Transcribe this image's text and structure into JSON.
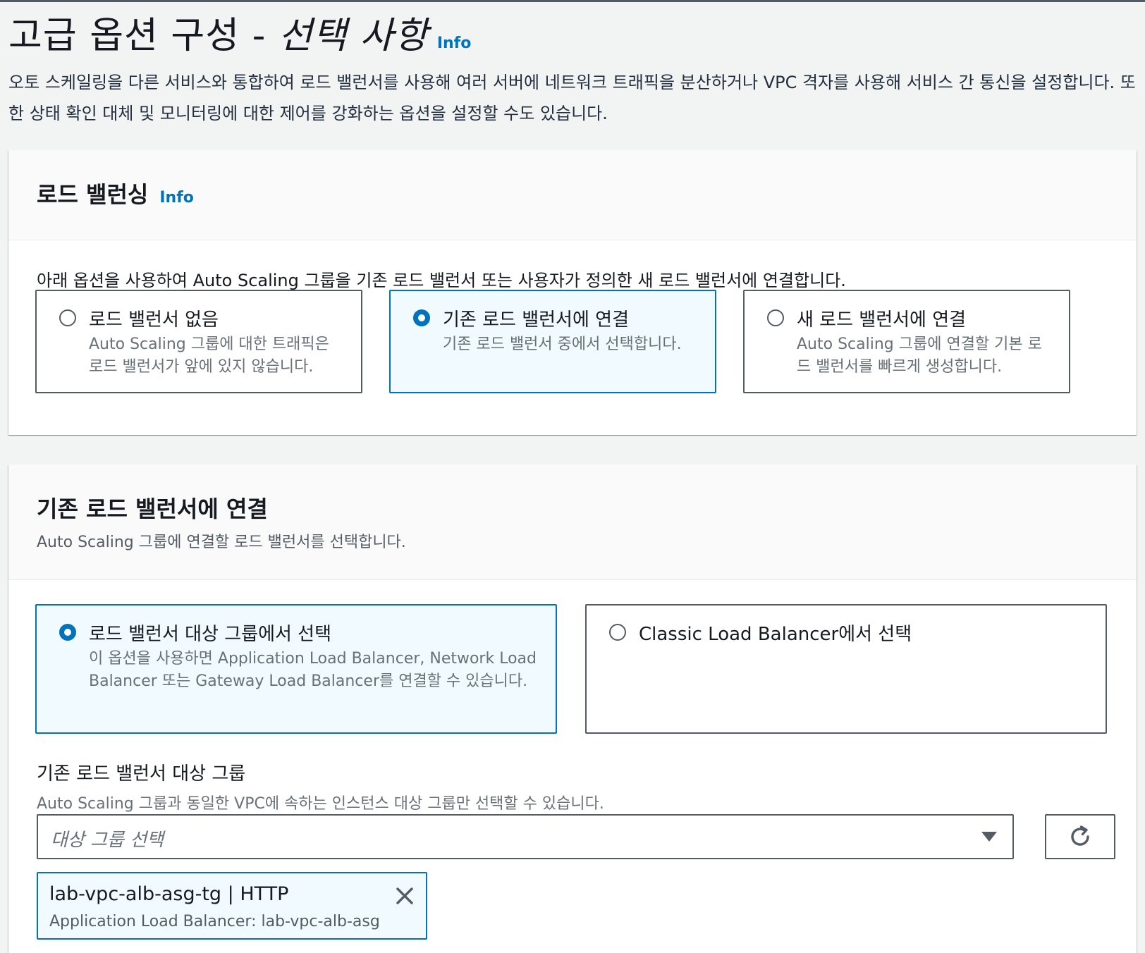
{
  "header": {
    "title_plain": "고급 옵션 구성 - ",
    "title_italic": "선택 사항",
    "info": "Info",
    "description": "오토 스케일링을 다른 서비스와 통합하여 로드 밸런서를 사용해 여러 서버에 네트워크 트래픽을 분산하거나 VPC 격자를 사용해 서비스 간 통신을 설정합니다. 또한 상태 확인 대체 및 모니터링에 대한 제어를 강화하는 옵션을 설정할 수도 있습니다."
  },
  "load_balancing": {
    "title": "로드 밸런싱",
    "info": "Info",
    "lead": "아래 옵션을 사용하여 Auto Scaling 그룹을 기존 로드 밸런서 또는 사용자가 정의한 새 로드 밸런서에 연결합니다.",
    "options": [
      {
        "label": "로드 밸런서 없음",
        "desc": "Auto Scaling 그룹에 대한 트래픽은 로드 밸런서가 앞에 있지 않습니다.",
        "selected": false
      },
      {
        "label": "기존 로드 밸런서에 연결",
        "desc": "기존 로드 밸런서 중에서 선택합니다.",
        "selected": true
      },
      {
        "label": "새 로드 밸런서에 연결",
        "desc": "Auto Scaling 그룹에 연결할 기본 로드 밸런서를 빠르게 생성합니다.",
        "selected": false
      }
    ]
  },
  "attach_existing": {
    "title": "기존 로드 밸런서에 연결",
    "subtitle": "Auto Scaling 그룹에 연결할 로드 밸런서를 선택합니다.",
    "options": [
      {
        "label": "로드 밸런서 대상 그룹에서 선택",
        "desc": "이 옵션을 사용하면 Application Load Balancer, Network Load Balancer 또는 Gateway Load Balancer를 연결할 수 있습니다.",
        "selected": true
      },
      {
        "label": "Classic Load Balancer에서 선택",
        "desc": "",
        "selected": false
      }
    ],
    "target_groups": {
      "label": "기존 로드 밸런서 대상 그룹",
      "description": "Auto Scaling 그룹과 동일한 VPC에 속하는 인스턴스 대상 그룹만 선택할 수 있습니다.",
      "placeholder": "대상 그룹 선택",
      "selected_token": {
        "title": "lab-vpc-alb-asg-tg | HTTP",
        "subtitle": "Application Load Balancer: lab-vpc-alb-asg"
      }
    }
  },
  "icons": {
    "refresh": "refresh-icon",
    "dismiss": "close-icon",
    "dropdown": "caret-down-icon"
  },
  "colors": {
    "accent": "#0073bb",
    "selected_bg": "#f1faff",
    "page_bg": "#f2f3f3",
    "border": "#545b64"
  }
}
